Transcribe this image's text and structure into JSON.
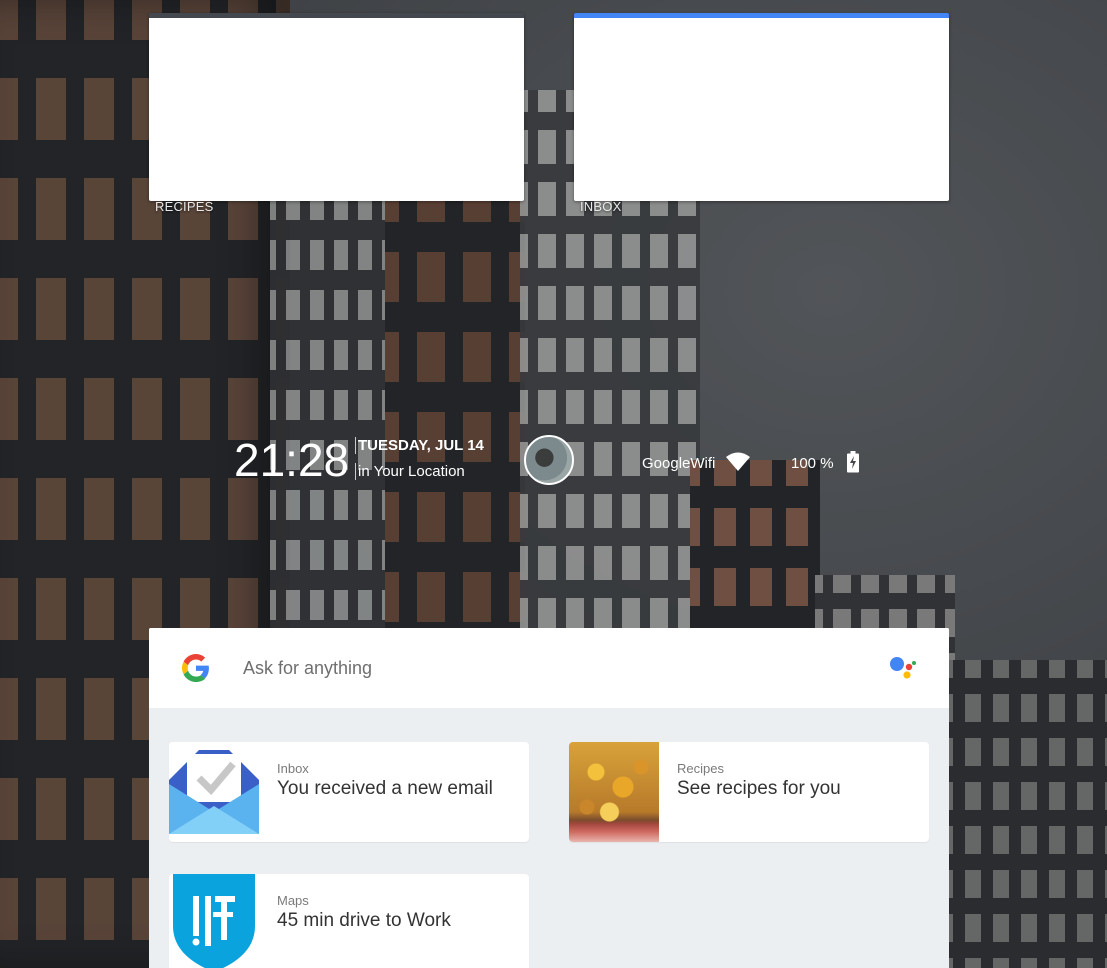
{
  "widgets": {
    "left_label": "RECIPES",
    "right_label": "INBOX"
  },
  "status": {
    "time": "21:28",
    "date": "TUESDAY, JUL 14",
    "location": "in Your Location",
    "wifi_name": "GoogleWifi",
    "battery": "100 %"
  },
  "search": {
    "placeholder": "Ask for anything"
  },
  "cards": [
    {
      "source": "Inbox",
      "message": "You received a new email",
      "icon": "inbox-app-icon"
    },
    {
      "source": "Recipes",
      "message": "See recipes for you",
      "icon": "recipe-photo"
    },
    {
      "source": "Maps",
      "message": "45 min drive to Work",
      "icon": "ist-logo"
    }
  ],
  "colors": {
    "accent_blue": "#4285f4",
    "widget_dark_border": "#42484d",
    "panel_bg": "#eceff1"
  }
}
